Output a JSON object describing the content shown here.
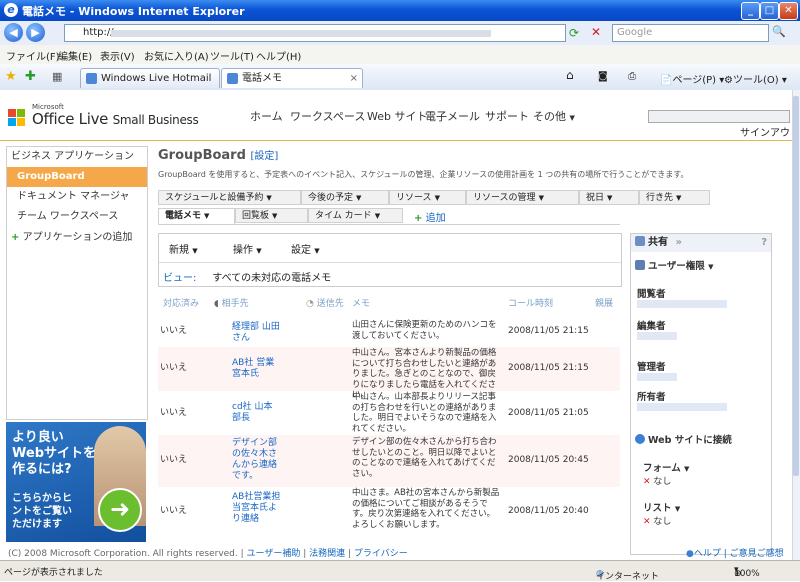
{
  "window": {
    "title": "電話メモ - Windows Internet Explorer",
    "min": "_",
    "max": "□",
    "close": "✕"
  },
  "address": {
    "url": "http://",
    "search_placeholder": "Google"
  },
  "menu": [
    "ファイル(F)",
    "編集(E)",
    "表示(V)",
    "お気に入り(A)",
    "ツール(T)",
    "ヘルプ(H)"
  ],
  "tabs": [
    {
      "label": "Windows Live Hotmail"
    },
    {
      "label": "電話メモ"
    }
  ],
  "browser_tools": {
    "page": "ページ(P)",
    "tools": "ツール(O)"
  },
  "header": {
    "logo_ms": "Microsoft",
    "logo_main": "Office Live",
    "logo_sub": "Small Business",
    "nav": [
      "ホーム",
      "ワークスペース",
      "Web サイト",
      "電子メール",
      "サポート",
      "その他"
    ],
    "signout": "サインアウト"
  },
  "sidebar": {
    "heading": "ビジネス アプリケーション",
    "items": [
      "GroupBoard",
      "ドキュメント マネージャ",
      "チーム ワークスペース"
    ],
    "add": "アプリケーションの追加"
  },
  "ad": {
    "line1": "より良い",
    "line2": "Webサイトを",
    "line3": "作るには?",
    "line4": "こちらからヒ",
    "line5": "ントをご覧い",
    "line6": "ただけます"
  },
  "main": {
    "title": "GroupBoard",
    "settings": "設定",
    "description": "GroupBoard を使用すると、予定表へのイベント記入、スケジュールの管理、企業リソースの使用計画を 1 つの共有の場所で行うことができます。",
    "tabs_row1": [
      "スケジュールと設備予約",
      "今後の予定",
      "リソース",
      "リソースの管理",
      "祝日",
      "行き先"
    ],
    "tabs_row2": [
      "電話メモ",
      "回覧板",
      "タイム カード"
    ],
    "add_tab": "追加",
    "toolbar": [
      "新規",
      "操作",
      "設定"
    ],
    "view_label": "ビュー:",
    "view_value": "すべての未対応の電話メモ",
    "columns": [
      "対応済み",
      "相手先",
      "送信先",
      "メモ",
      "コール時刻",
      "親展"
    ],
    "rows": [
      {
        "done": "いいえ",
        "party": "経理部 山田さん",
        "memo": "山田さんに保険更新のためのハンコを渡しておいてください。",
        "time": "2008/11/05 21:15"
      },
      {
        "done": "いいえ",
        "party": "AB社 営業 宮本氏",
        "memo": "中山さん。宮本さんより新製品の価格について打ち合わせしたいと連絡がありました。急ぎとのことなので、御戻りになりましたら電話を入れてください。",
        "time": "2008/11/05 21:15"
      },
      {
        "done": "いいえ",
        "party": "cd社 山本 部長",
        "memo": "中山さん。山本部長よりリリース記事の打ち合わせを行いとの連絡がありました。明日でよいそうなので連絡を入れてください。",
        "time": "2008/11/05 21:05"
      },
      {
        "done": "いいえ",
        "party": "デザイン部の佐々木さんから連絡です。",
        "memo": "デザイン部の佐々木さんから打ち合わせしたいとのこと。明日以降でよいとのことなので連絡を入れてあげてください。",
        "time": "2008/11/05 20:45"
      },
      {
        "done": "いいえ",
        "party": "AB社営業担当宮本氏より連絡",
        "memo": "中山さま。AB社の宮本さんから新製品の価格についてご相談があるそうです。戻り次第連絡を入れてください。よろしくお願いします。",
        "time": "2008/11/05 20:40"
      }
    ]
  },
  "panel": {
    "title": "共有",
    "help": "?",
    "perm": "ユーザー権限",
    "viewer": "閲覧者",
    "editor": "編集者",
    "admin": "管理者",
    "owner": "所有者",
    "connect": "Web サイトに接続",
    "form": "フォーム",
    "form_none": "なし",
    "list": "リスト",
    "list_none": "なし"
  },
  "footer": {
    "copyright": "(C) 2008 Microsoft Corporation. All rights reserved.",
    "links": [
      "ユーザー補助",
      "法務関連",
      "プライバシー"
    ],
    "help": "ヘルプ",
    "feedback": "ご意見ご感想"
  },
  "statusbar": {
    "text": "ページが表示されました",
    "zone": "インターネット",
    "zoom": "100%"
  },
  "colors": {
    "accent": "#f5a84a",
    "link": "#1565c0",
    "titlebar": "#0a55d6"
  }
}
